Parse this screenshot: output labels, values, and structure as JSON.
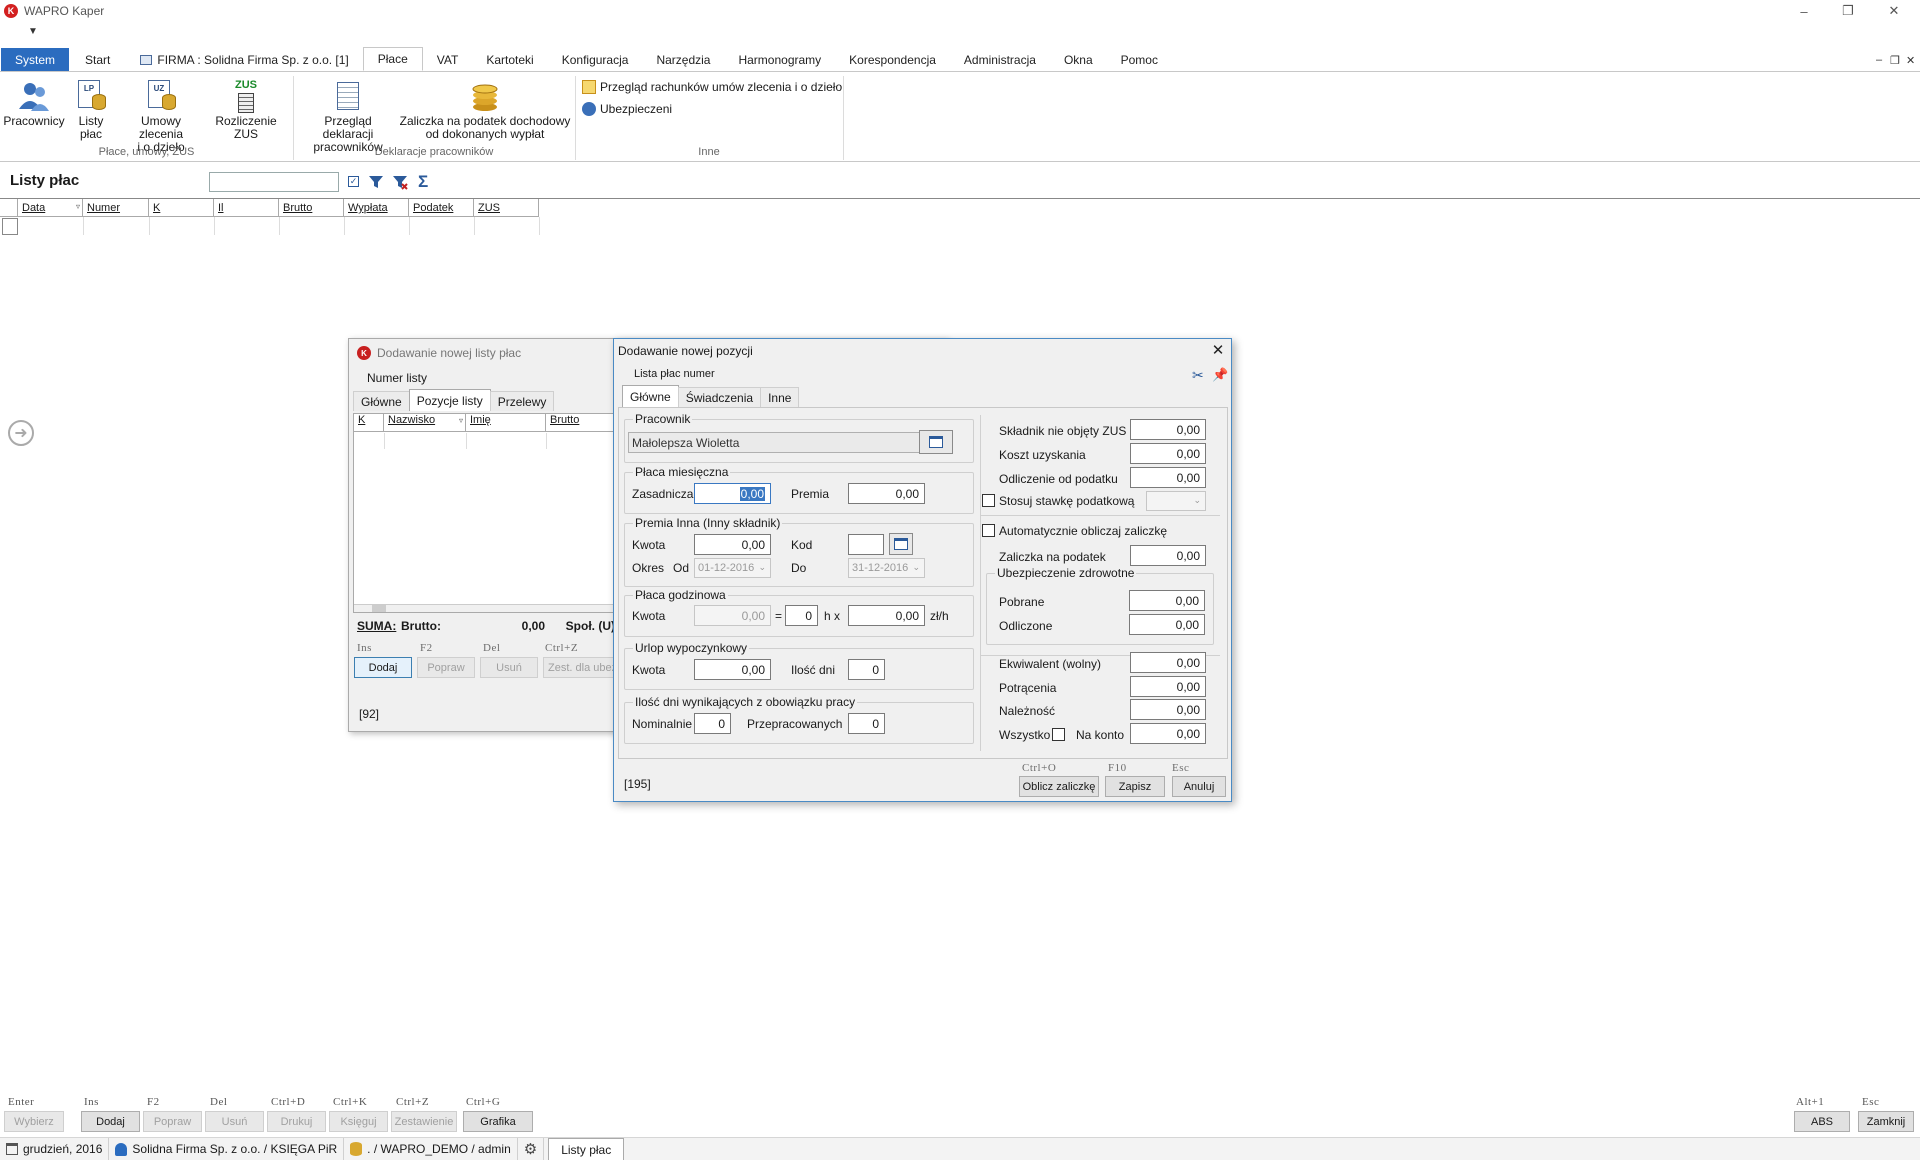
{
  "app": {
    "title": "WAPRO Kaper",
    "logo_letter": "K"
  },
  "menu": {
    "system": "System",
    "tabs": [
      "Start",
      "FIRMA : Solidna Firma Sp. z o.o. [1]",
      "Płace",
      "VAT",
      "Kartoteki",
      "Konfiguracja",
      "Narzędzia",
      "Harmonogramy",
      "Korespondencja",
      "Administracja",
      "Okna",
      "Pomoc"
    ],
    "active_tab": "Płace"
  },
  "ribbon": {
    "pracownicy": "Pracownicy",
    "listy_plac": "Listy płac",
    "umowy_l1": "Umowy zlecenia",
    "umowy_l2": "i o dzieło",
    "rozliczenie_zus": "Rozliczenie ZUS",
    "zus_icon_text": "ZUS",
    "lp_icon_text": "LP",
    "uz_icon_text": "UZ",
    "przeglad_l1": "Przegląd deklaracji",
    "przeglad_l2": "pracowników",
    "zaliczka_l1": "Zaliczka na podatek dochodowy",
    "zaliczka_l2": "od dokonanych wypłat",
    "przeglad_rach": "Przegląd rachunków umów zlecenia i o dzieło",
    "ubezpieczeni": "Ubezpieczeni",
    "group1": "Płace, umowy, ZUS",
    "group2": "Deklaracje pracowników",
    "group3": "Inne"
  },
  "list": {
    "title": "Listy płac",
    "columns": [
      "Data",
      "Numer",
      "K",
      "Il",
      "Brutto",
      "Wypłata",
      "Podatek",
      "ZUS"
    ]
  },
  "dialog1": {
    "title": "Dodawanie nowej listy płac",
    "numer_label": "Numer listy",
    "tabs": [
      "Główne",
      "Pozycje listy",
      "Przelewy"
    ],
    "active_tab": "Pozycje listy",
    "columns": [
      "K",
      "Nazwisko",
      "Imię",
      "Brutto"
    ],
    "suma_label": "SUMA:",
    "brutto_label": "Brutto:",
    "brutto_value": "0,00",
    "spol_label": "Społ. (U)",
    "keys": [
      "Ins",
      "F2",
      "Del",
      "Ctrl+Z"
    ],
    "buttons": [
      "Dodaj",
      "Popraw",
      "Usuń",
      "Zest. dla ubez"
    ],
    "footer_code": "[92]"
  },
  "dialog2": {
    "title": "Dodawanie nowej pozycji",
    "lista_label": "Lista płac numer",
    "tabs": [
      "Główne",
      "Świadczenia",
      "Inne"
    ],
    "active_tab": "Główne",
    "pracownik": {
      "title": "Pracownik",
      "value": "Małolepsza Wioletta"
    },
    "placa_miesieczna": {
      "title": "Płaca miesięczna",
      "zasadnicza_label": "Zasadnicza",
      "zasadnicza_value": "0,00",
      "premia_label": "Premia",
      "premia_value": "0,00"
    },
    "premia_inna": {
      "title": "Premia Inna (Inny składnik)",
      "kwota_label": "Kwota",
      "kwota_value": "0,00",
      "kod_label": "Kod",
      "okres_label": "Okres",
      "od_label": "Od",
      "od_value": "01-12-2016",
      "do_label": "Do",
      "do_value": "31-12-2016"
    },
    "placa_godzinowa": {
      "title": "Płaca godzinowa",
      "kwota_label": "Kwota",
      "kwota_value": "0,00",
      "eq": "=",
      "hours": "0",
      "hx": "h x",
      "rate": "0,00",
      "unit": "zł/h"
    },
    "urlop": {
      "title": "Urlop wypoczynkowy",
      "kwota_label": "Kwota",
      "kwota_value": "0,00",
      "dni_label": "Ilość dni",
      "dni_value": "0"
    },
    "dni_pracy": {
      "title": "Ilość dni wynikających z obowiązku pracy",
      "nominalnie_label": "Nominalnie",
      "nominalnie_value": "0",
      "przepracowanych_label": "Przepracowanych",
      "przepracowanych_value": "0"
    },
    "right": {
      "skladnik_label": "Składnik nie objęty ZUS",
      "skladnik_value": "0,00",
      "koszt_label": "Koszt uzyskania",
      "koszt_value": "0,00",
      "odliczenie_label": "Odliczenie od podatku",
      "odliczenie_value": "0,00",
      "stosuj_label": "Stosuj stawkę podatkową",
      "auto_label": "Automatycznie obliczaj zaliczkę",
      "zaliczka_label": "Zaliczka na podatek",
      "zaliczka_value": "0,00",
      "ubezp_title": "Ubezpieczenie zdrowotne",
      "pobrane_label": "Pobrane",
      "pobrane_value": "0,00",
      "odliczone_label": "Odliczone",
      "odliczone_value": "0,00",
      "ekwiwalent_label": "Ekwiwalent (wolny)",
      "ekwiwalent_value": "0,00",
      "potracenia_label": "Potrącenia",
      "potracenia_value": "0,00",
      "naleznosc_label": "Należność",
      "naleznosc_value": "0,00",
      "wszystko_label": "Wszystko",
      "na_konto_label": "Na konto",
      "na_konto_value": "0,00"
    },
    "footer_code": "[195]",
    "keys": [
      "Ctrl+O",
      "F10",
      "Esc"
    ],
    "buttons": [
      "Oblicz zaliczkę",
      "Zapisz",
      "Anuluj"
    ]
  },
  "bottom": {
    "keys": [
      "Enter",
      "Ins",
      "F2",
      "Del",
      "Ctrl+D",
      "Ctrl+K",
      "Ctrl+Z",
      "Ctrl+G"
    ],
    "buttons": [
      "Wybierz",
      "Dodaj",
      "Popraw",
      "Usuń",
      "Drukuj",
      "Księguj",
      "Zestawienie",
      "Grafika"
    ],
    "right_keys": [
      "Alt+1",
      "Esc"
    ],
    "right_buttons": [
      "ABS",
      "Zamknij"
    ]
  },
  "status": {
    "period": "grudzień, 2016",
    "company": "Solidna Firma Sp. z o.o. / KSIĘGA PiR",
    "db": ". / WAPRO_DEMO / admin",
    "window_tab": "Listy płac"
  }
}
